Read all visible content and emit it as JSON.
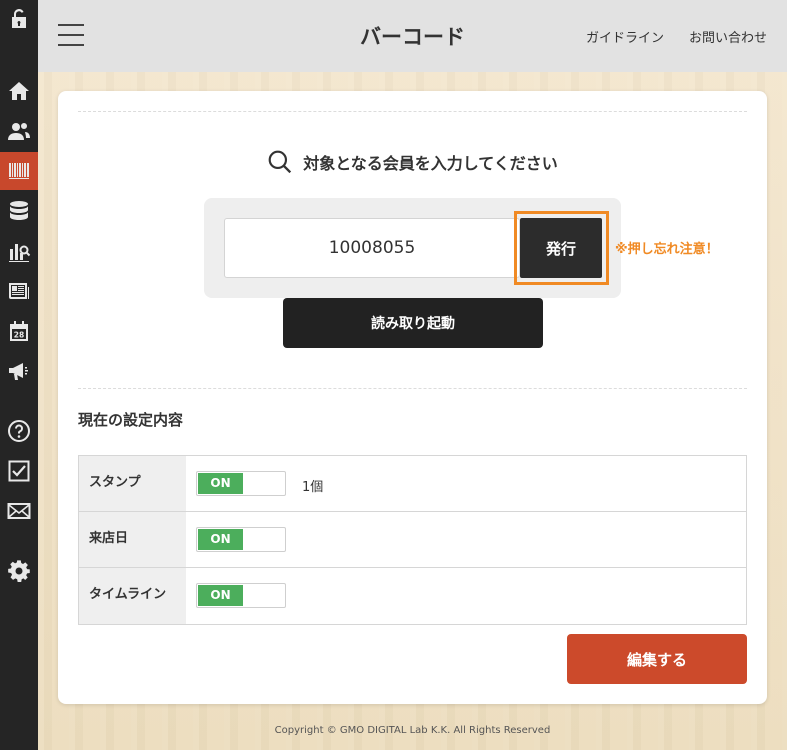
{
  "header": {
    "title": "バーコード",
    "links": [
      "ガイドライン",
      "お問い合わせ"
    ]
  },
  "sidebar": {
    "items": [
      {
        "icon": "unlock-icon",
        "active": false
      },
      {
        "icon": "home-icon",
        "active": false
      },
      {
        "icon": "users-icon",
        "active": false
      },
      {
        "icon": "barcode-icon",
        "active": true
      },
      {
        "icon": "database-icon",
        "active": false
      },
      {
        "icon": "analytics-icon",
        "active": false
      },
      {
        "icon": "news-icon",
        "active": false
      },
      {
        "icon": "calendar-icon",
        "active": false,
        "text": "28"
      },
      {
        "icon": "megaphone-icon",
        "active": false
      },
      {
        "icon": "help-icon",
        "active": false
      },
      {
        "icon": "checkbox-icon",
        "active": false
      },
      {
        "icon": "mail-icon",
        "active": false
      },
      {
        "icon": "gear-icon",
        "active": false
      }
    ]
  },
  "main": {
    "prompt": "対象となる会員を入力してください",
    "member_input": {
      "value": "10008055",
      "placeholder": ""
    },
    "issue_label": "発行",
    "warning": "※押し忘れ注意！",
    "scan_label": "読み取り起動",
    "settings_title": "現在の設定内容",
    "settings": [
      {
        "label": "スタンプ",
        "toggle": "ON",
        "extra": "1個"
      },
      {
        "label": "来店日",
        "toggle": "ON",
        "extra": ""
      },
      {
        "label": "タイムライン",
        "toggle": "ON",
        "extra": ""
      }
    ],
    "edit_label": "編集する"
  },
  "footer": {
    "copyright": "Copyright © GMO DIGITAL Lab K.K. All Rights Reserved"
  },
  "colors": {
    "accent": "#cc4a2b",
    "highlight": "#f08a24",
    "toggle_on": "#4cae5c",
    "sidebar_bg": "#252525"
  }
}
